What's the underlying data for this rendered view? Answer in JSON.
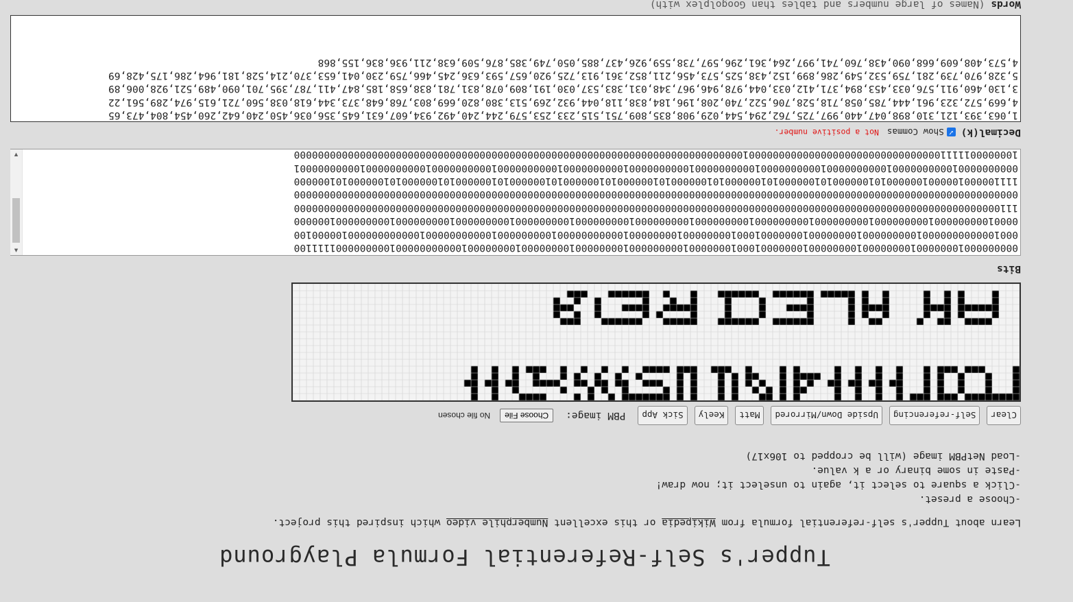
{
  "title": "Tupper's Self-Referential Formula Playground",
  "intro": {
    "before": "Learn about Tupper's self-referential formula from ",
    "link1": "Wikipedia",
    "middle": " or this excellent ",
    "link2": "Numberphile video",
    "after": " which inspired this project."
  },
  "steps": [
    "-Choose a preset.",
    "-Click a square to select it, again to unselect it; now draw!",
    "-Paste in some binary or a k value.",
    "-Load NetPBM image (will be cropped to 106x17)"
  ],
  "toolbar": {
    "buttons": [
      "Clear",
      "Self-referencing",
      "Upside Down/Mirrored",
      "Matt",
      "Keely",
      "Sick App"
    ],
    "pbm_label": "PBM image:",
    "file_button": "Choose File",
    "file_status": "No file chosen"
  },
  "grid": {
    "cols": 106,
    "rows": 17,
    "on_color": "#000000",
    "off_color": "#f3f3f3",
    "line_color": "#cfcfcf",
    "text_rows": [
      "######## ### ### #  #  #  #     # # ##   # #   # # ####### #  # #    ####   #  #                         ",
      "#   #   #  # #   #  #  #  #    ## # # #  # #   # # #     #  # #   #      #  #  #                         ",
      "#   #   #  # #   ## ## ## ##  # # #  # # # #   # #  ###  ## ## ##  ####  ## ## ##                        ",
      "#   #   #  # #   #  #  #  #  #### #   ## # #   # #     #  #  #  # #   #  #  #  #                         ",
      "#    ### ### #   #  #  #  #     # #    #  ###  ### ####  #  #  #  #  ### #  #  #                         ",
      "                                                                                                        ",
      "                                                                                                        ",
      "                                                                                                        ",
      "                                                                                                        ",
      "                                                                                                        ",
      "                                                                                                        ",
      "    ####  ##  #     ##  #     ######  ######   #####   ######   ###                                    ",
      "   #    # #  #     #  # #     #      #    #    #    # #      #  #  #                                   ",
      "   ###### ####     #### #     ####   #    #    #####  ####   #   ###                                    ",
      "   #    # #  #     #  # #     #      #    #    #  #   #      #  #  #                                   ",
      "   #    # #  #     #  # ##### ######  ######   #   #  ######   ###                                     ",
      "                                                                                                        "
    ]
  },
  "bits": {
    "label": "Bits",
    "lines": [
      "0000000001000000010000000010000000010000000100010000000100000000010000000010000000010000000010000000000010000000001111100",
      "0001000000000000100000000010000000010000000100010000000010000000010000000000010000000001000000000001000000000000100000100",
      "0000100000000010000000001000000000100000000010000000001000000000100000000010000000001000000000100000000010000000001000000",
      "1110000000000000000000000000000000000000000000000000000000000000000000000000000000000000000000000000000000000000000000000",
      "0000000000000000000000000000000000000000000000000000000000000000000000000000000000000000000000000000000000000000000000000",
      "1111000001000001000000101000000101000000101000000101000000101000000101000000101000000101000000101000000101000000101000000",
      "0000000000100000000001000000000010000000000100000000001000000000010000000000100000000001000000000010000000000100000000001",
      "1000000011111000000000000000000000000000000001000000000000000000000000000000000000000000000000000000000000000000000000000"
    ]
  },
  "decimal": {
    "label": "Decimal(k)",
    "show_commas": "Show Commas",
    "warning": "Not a positive number.",
    "lines": [
      "1,063,393,121,310,898,047,440,997,725,762,294,544,029,908,835,809,751,515,233,253,579,244,240,492,934,607,631,645,356,036,450,240,642,260,454,804,473,65",
      "4,669,572,323,961,444,785,058,718,528,706,522,740,208,196,184,838,118,044,932,269,513,380,820,669,803,768,648,373,344,618,038,560,721,615,974,289,561,22",
      "3,130,460,911,576,033,453,894,371,412,033,044,978,946,967,348,031,383,537,030,191,809,078,831,781,838,658,185,847,411,787,395,701,090,489,521,928,006,89",
      "5,328,970,739,281,759,532,549,286,899,152,438,525,573,456,211,852,361,913,725,920,657,593,636,245,466,759,230,041,653,370,214,528,181,964,286,175,428,69",
      "4,573,408,609,668,090,438,760,741,997,264,361,296,597,738,559,926,437,885,050,749,385,876,509,638,211,936,836,155,868"
    ]
  },
  "words_label": "Words",
  "words_note": "(Names of large numbers and tables than Googolplex with)"
}
